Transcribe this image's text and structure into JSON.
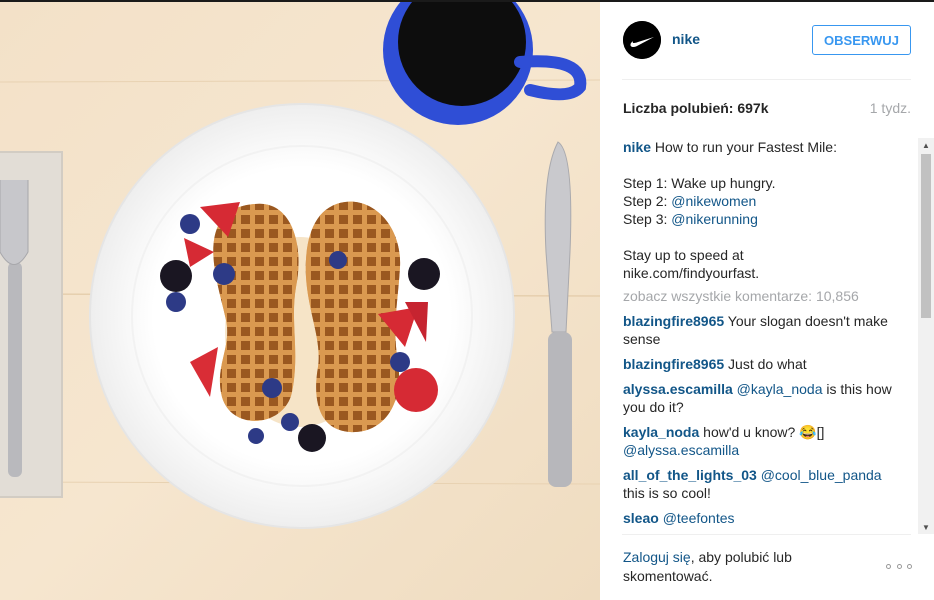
{
  "post": {
    "username": "nike",
    "follow_label": "OBSERWUJ",
    "likes": "Liczba polubień: 697k",
    "time_ago": "1 tydz."
  },
  "caption": {
    "username": "nike",
    "line1": " How to run your Fastest Mile:",
    "step1": "Step 1: Wake up hungry.",
    "step2_text": "Step 2: ",
    "step2_mention": "@nikewomen",
    "step3_text": "Step 3: ",
    "step3_mention": "@nikerunning",
    "line_speed1": "Stay up to speed at",
    "line_speed2": "nike.com/findyourfast."
  },
  "view_all": "zobacz wszystkie komentarze: 10,856",
  "comments": [
    {
      "user": "blazingfire8965",
      "mention": "",
      "text": " Your slogan doesn't make sense"
    },
    {
      "user": "blazingfire8965",
      "mention": "",
      "text": " Just do what"
    },
    {
      "user": "alyssa.escamilla",
      "mention": " @kayla_noda",
      "text": " is this how you do it?"
    },
    {
      "user": "kayla_noda",
      "mention": "",
      "text": " how'd u know? 😂[]",
      "mention_after": "@alyssa.escamilla"
    },
    {
      "user": "all_of_the_lights_03",
      "mention": " @cool_blue_panda",
      "text": " this is so cool!"
    },
    {
      "user": "sleao",
      "mention": " @teefontes",
      "text": ""
    }
  ],
  "footer": {
    "login_link": "Zaloguj się",
    "rest": ", aby polubić lub skomentować."
  },
  "icons": {
    "avatar": "nike-swoosh-logo",
    "more": "more-options-icon",
    "scroll_up": "scroll-up-arrow",
    "scroll_down": "scroll-down-arrow"
  },
  "colors": {
    "link": "#125688",
    "follow": "#3897f0",
    "muted": "#a5a7aa"
  }
}
